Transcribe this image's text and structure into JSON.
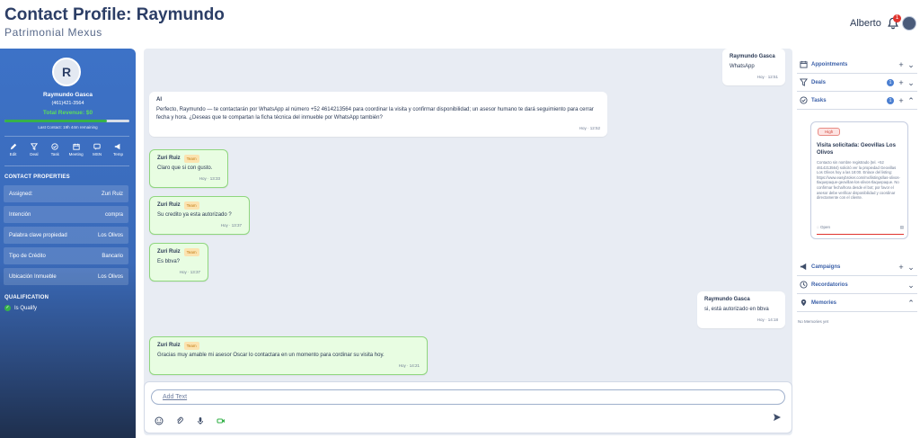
{
  "header": {
    "title": "Contact Profile: Raymundo",
    "subtitle": "Patrimonial Mexus",
    "user_name": "Alberto",
    "notification_count": "1"
  },
  "sidebar": {
    "avatar_initial": "R",
    "name": "Raymundo Gasca",
    "phone": "(461)421-3564",
    "revenue": "Total Revenue: $0",
    "revenue_progress": 0.82,
    "last_contact": "Last Contact: 19h 44m remaining",
    "actions": [
      {
        "label": "Edit",
        "icon": "pencil-icon"
      },
      {
        "label": "Deal",
        "icon": "funnel-icon"
      },
      {
        "label": "Task",
        "icon": "check-circle-icon"
      },
      {
        "label": "Meeting",
        "icon": "calendar-icon"
      },
      {
        "label": "MSN",
        "icon": "message-icon"
      },
      {
        "label": "Temp",
        "icon": "megaphone-icon"
      }
    ],
    "contact_properties_heading": "CONTACT PROPERTIES",
    "properties": [
      {
        "label": "Assigned:",
        "value": "Zuri Ruiz"
      },
      {
        "label": "Intención",
        "value": "compra"
      },
      {
        "label": "Palabra clave propiedad",
        "value": "Los Olivos"
      },
      {
        "label": "Tipo de Crédito",
        "value": "Bancario"
      },
      {
        "label": "Ubicación Inmueble",
        "value": "Los Olivos"
      }
    ],
    "qualification_heading": "QUALIFICATION",
    "qualification_status": "Is Qualify"
  },
  "chat": {
    "messages": [
      {
        "sender": "Raymundo Gasca",
        "text": "WhatsApp",
        "time": "Hoy · 12:51"
      },
      {
        "sender": "AI",
        "text": "Perfecto, Raymundo — te contactarán por WhatsApp al número +52 4614213564 para coordinar la visita y confirmar disponibilidad; un asesor humano te dará seguimiento para cerrar fecha y hora. ¿Deseas que te compartan la ficha técnica del inmueble por WhatsApp también?",
        "time": "Hoy · 12:52"
      },
      {
        "sender": "Zuri Ruiz",
        "tag": "Team",
        "text": "Claro que si con gusto.",
        "time": "Hoy · 13:33"
      },
      {
        "sender": "Zuri Ruiz",
        "tag": "Team",
        "text": "Su credito ya esta autorizado ?",
        "time": "Hoy · 13:37"
      },
      {
        "sender": "Zuri Ruiz",
        "tag": "Team",
        "text": "Es bbva?",
        "time": "Hoy · 13:37"
      },
      {
        "sender": "Raymundo Gasca",
        "text": "si, está autorizado en bbva",
        "time": "Hoy · 14:18"
      },
      {
        "sender": "Zuri Ruiz",
        "tag": "Team",
        "text": "Gracias muy amable mi asesor Oscar lo contactara en un momento para cordinar su visita hoy.",
        "time": "Hoy · 14:21"
      }
    ],
    "composer_placeholder": "Add Text"
  },
  "right_panel": {
    "appointments_label": "Appointments",
    "deals_label": "Deals",
    "deals_count": "1",
    "tasks_label": "Tasks",
    "tasks_count": "1",
    "task": {
      "priority": "High",
      "title": "Visita solicitada: Geovillas Los Olivos",
      "description": "Contacto sin nombre registrado (tel. +52 4614213564) solicitó ver la propiedad Geovillas Los Olivos hoy a las 18:00. Enlace del listing: https://www.easybroker.com/mx/listings/las-olivos-tlaquepaque-geovillas-los-olivos-tlaquepaque. No confirmar fecha/hora desde el bot; por favor el asesor debe verificar disponibilidad y coordinar directamente con el cliente.",
      "status": "Open"
    },
    "campaigns_label": "Campaigns",
    "recordatorios_label": "Recordatorios",
    "memories_label": "Memories",
    "no_memories": "No Memories yet"
  },
  "colors": {
    "sidebar_blue": "#3d72c7",
    "accent_green": "#36b24a",
    "team_bubble": "#e8fde2",
    "badge_red": "#e0342e"
  }
}
